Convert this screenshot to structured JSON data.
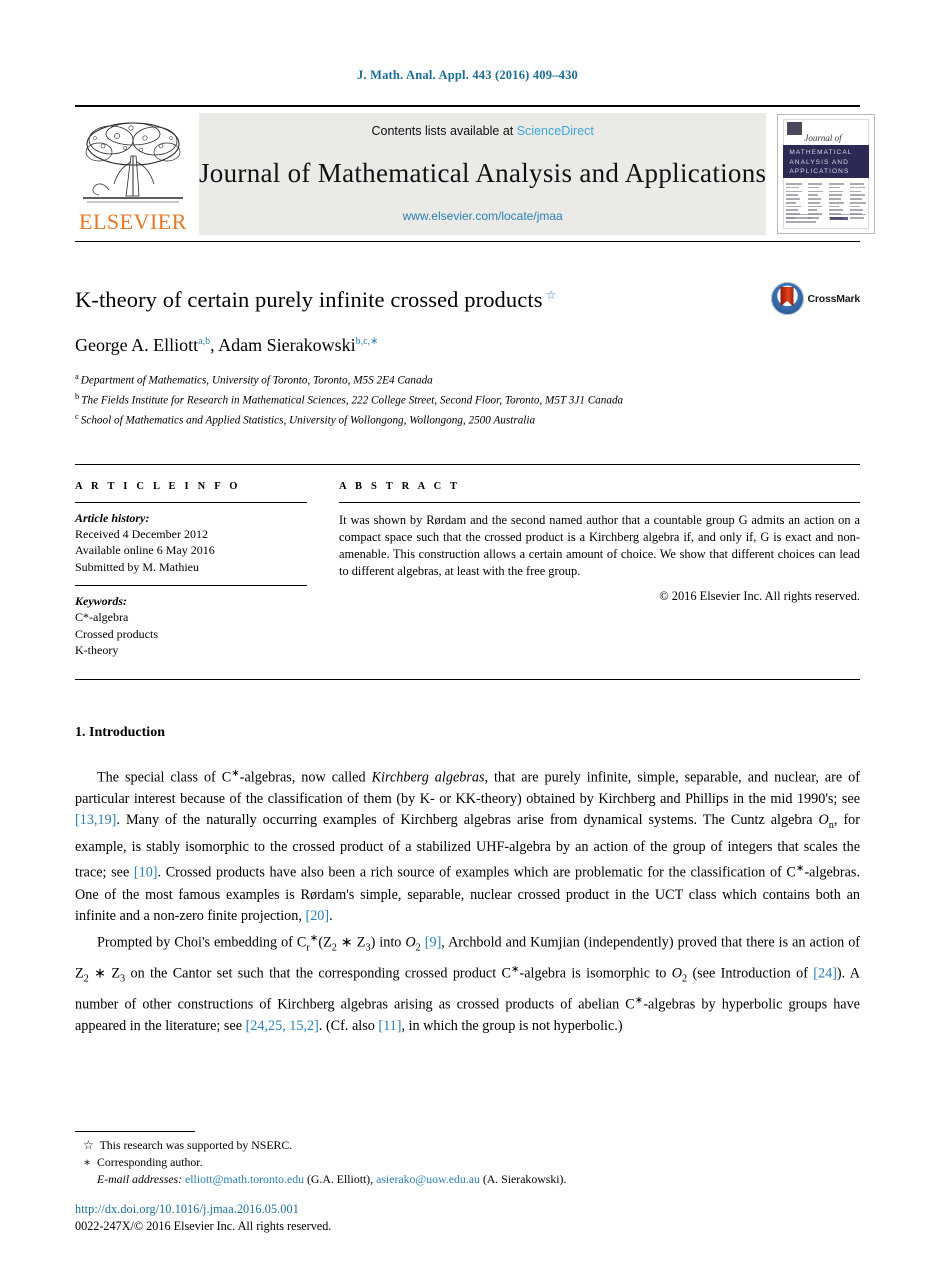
{
  "running_head": "J. Math. Anal. Appl. 443 (2016) 409–430",
  "masthead": {
    "publisher_name": "ELSEVIER",
    "contents_prefix": "Contents lists available at ",
    "sciencedirect": "ScienceDirect",
    "journal_title": "Journal of Mathematical Analysis and Applications",
    "journal_url": "www.elsevier.com/locate/jmaa",
    "cover": {
      "journal_of": "Journal of",
      "band_line1": "MATHEMATICAL",
      "band_line2": "ANALYSIS AND",
      "band_line3": "APPLICATIONS"
    }
  },
  "article": {
    "title": "K-theory of certain purely infinite crossed products",
    "title_footnote_mark": "☆",
    "crossmark_label": "CrossMark",
    "authors_prefix": "George A. Elliott",
    "author1_marks": "a,b",
    "authors_middle": ", Adam Sierakowski",
    "author2_marks": "b,c,∗",
    "affiliations": [
      {
        "mark": "a",
        "text": "Department of Mathematics, University of Toronto, Toronto, M5S 2E4 Canada"
      },
      {
        "mark": "b",
        "text": "The Fields Institute for Research in Mathematical Sciences, 222 College Street, Second Floor, Toronto, M5T 3J1 Canada"
      },
      {
        "mark": "c",
        "text": "School of Mathematics and Applied Statistics, University of Wollongong, Wollongong, 2500 Australia"
      }
    ]
  },
  "article_info": {
    "heading": "A R T I C L E     I N F O",
    "history_label": "Article history:",
    "history": [
      "Received 4 December 2012",
      "Available online 6 May 2016",
      "Submitted by M. Mathieu"
    ],
    "keywords_label": "Keywords:",
    "keywords": [
      "C*-algebra",
      "Crossed products",
      "K-theory"
    ]
  },
  "abstract": {
    "heading": "A B S T R A C T",
    "text": "It was shown by Rørdam and the second named author that a countable group G admits an action on a compact space such that the crossed product is a Kirchberg algebra if, and only if, G is exact and non-amenable. This construction allows a certain amount of choice. We show that different choices can lead to different algebras, at least with the free group.",
    "copyright": "© 2016 Elsevier Inc. All rights reserved."
  },
  "body": {
    "section_number_title": "1.  Introduction",
    "paragraph1": {
      "p1": "The special class of C",
      "p2": "-algebras, now called ",
      "p3": "Kirchberg algebras",
      "p4": ", that are purely infinite, simple, separable, and nuclear, are of particular interest because of the classification of them (by K- or KK-theory) obtained by Kirchberg and Phillips in the mid 1990's; see ",
      "ref1": "[13,19]",
      "p5": ". Many of the naturally occurring examples of Kirchberg algebras arise from dynamical systems. The Cuntz algebra ",
      "cuntz": "O",
      "cuntz_sub": "n",
      "p6": ", for example, is stably isomorphic to the crossed product of a stabilized UHF-algebra by an action of the group of integers that scales the trace; see ",
      "ref2": "[10]",
      "p7": ". Crossed products have also been a rich source of examples which are problematic for the classification of C",
      "p8": "-algebras. One of the most famous examples is Rørdam's simple, separable, nuclear crossed product in the UCT class which contains both an infinite and a non-zero finite projection, ",
      "ref3": "[20]",
      "p9": "."
    },
    "paragraph2": {
      "p1": "Prompted by Choi's embedding of C",
      "sub_r": "r",
      "star": "∗",
      "p2": "(Z",
      "sub2": "2",
      "p3": " ∗ Z",
      "sub3": "3",
      "p4": ") into ",
      "o2": "O",
      "o2sub": "2",
      "p5": " ",
      "ref1": "[9]",
      "p6": ", Archbold and Kumjian (independently) proved that there is an action of Z",
      "p7": " ∗ Z",
      "p8": " on the Cantor set such that the corresponding crossed product C",
      "p9": "-algebra is isomorphic to ",
      "p10": " (see Introduction of ",
      "ref2": "[24]",
      "p11": "). A number of other constructions of Kirchberg algebras arising as crossed products of abelian C",
      "p12": "-algebras by hyperbolic groups have appeared in the literature; see ",
      "ref3": "[24,25, 15,2]",
      "p13": ". (Cf. also ",
      "ref4": "[11]",
      "p14": ", in which the group is not hyperbolic.)"
    }
  },
  "footnotes": {
    "note1_symbol": "☆",
    "note1_text": "This research was supported by NSERC.",
    "note2_symbol": "∗",
    "note2_text": "Corresponding author.",
    "email_label": "E-mail addresses:",
    "email1": "elliott@math.toronto.edu",
    "email1_owner": "(G.A. Elliott),",
    "email2": "asierako@uow.edu.au",
    "email2_owner": "(A. Sierakowski)."
  },
  "footer": {
    "doi": "http://dx.doi.org/10.1016/j.jmaa.2016.05.001",
    "issn_line": "0022-247X/© 2016 Elsevier Inc. All rights reserved."
  },
  "colors": {
    "link": "#2b7fb8",
    "running_head": "#1a6e96",
    "sciencedirect": "#3aa7db",
    "elsevier_orange": "#E87722",
    "cover_band": "#2c2a55"
  }
}
